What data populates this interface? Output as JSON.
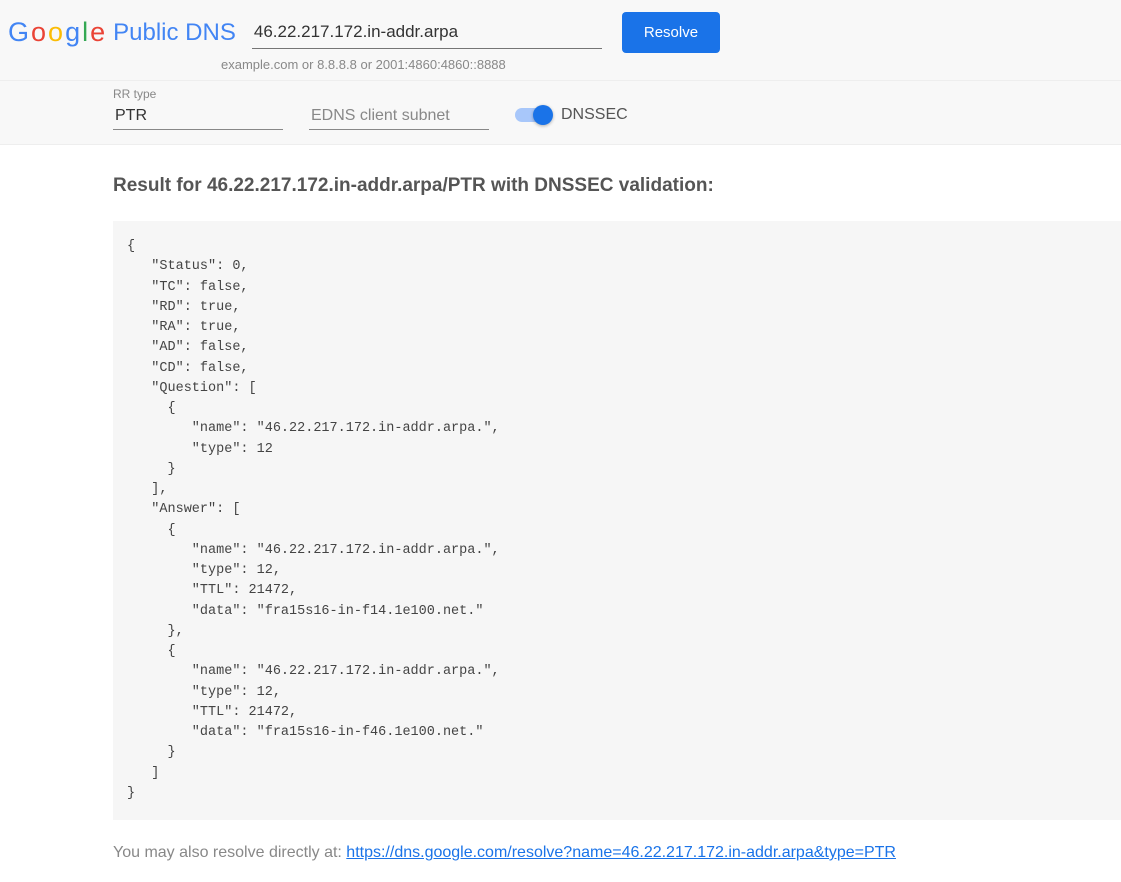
{
  "header": {
    "product_name": "Public DNS",
    "domain_value": "46.22.217.172.in-addr.arpa",
    "domain_hint": "example.com or 8.8.8.8 or 2001:4860:4860::8888",
    "resolve_label": "Resolve"
  },
  "options": {
    "rr_type_label": "RR type",
    "rr_type_value": "PTR",
    "edns_placeholder": "EDNS client subnet",
    "dnssec_label": "DNSSEC"
  },
  "result": {
    "heading": "Result for 46.22.217.172.in-addr.arpa/PTR with DNSSEC validation:",
    "json_text": "{\n   \"Status\": 0,\n   \"TC\": false,\n   \"RD\": true,\n   \"RA\": true,\n   \"AD\": false,\n   \"CD\": false,\n   \"Question\": [\n     {\n        \"name\": \"46.22.217.172.in-addr.arpa.\",\n        \"type\": 12\n     }\n   ],\n   \"Answer\": [\n     {\n        \"name\": \"46.22.217.172.in-addr.arpa.\",\n        \"type\": 12,\n        \"TTL\": 21472,\n        \"data\": \"fra15s16-in-f14.1e100.net.\"\n     },\n     {\n        \"name\": \"46.22.217.172.in-addr.arpa.\",\n        \"type\": 12,\n        \"TTL\": 21472,\n        \"data\": \"fra15s16-in-f46.1e100.net.\"\n     }\n   ]\n}"
  },
  "footer": {
    "prefix": "You may also resolve directly at: ",
    "link_text": "https://dns.google.com/resolve?name=46.22.217.172.in-addr.arpa&type=PTR"
  }
}
